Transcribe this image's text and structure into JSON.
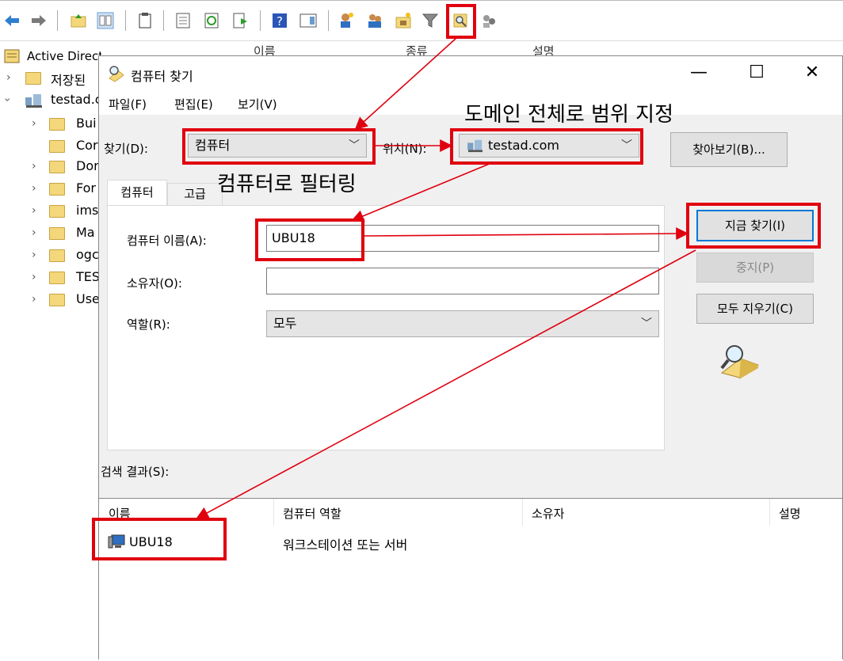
{
  "tree": {
    "root": "Active Directory 사용자 및 컴퓨터",
    "saved": "저장된",
    "domain": "testad.c",
    "children": [
      "Bui",
      "Cor",
      "Dor",
      "For",
      "ims",
      "Ma",
      "ogc",
      "TES",
      "Use"
    ]
  },
  "bg_columns": [
    "이름",
    "종류",
    "설명"
  ],
  "dialog": {
    "title": "컴퓨터 찾기",
    "menu": [
      "파일(F)",
      "편집(E)",
      "보기(V)"
    ],
    "find_label": "찾기(D):",
    "find_value": "컴퓨터",
    "in_label": "위치(N):",
    "in_value": "testad.com",
    "browse_label": "찾아보기(B)...",
    "tabs": [
      "컴퓨터",
      "고급"
    ],
    "name_label": "컴퓨터 이름(A):",
    "name_value": "UBU18",
    "owner_label": "소유자(O):",
    "owner_value": "",
    "role_label": "역할(R):",
    "role_value": "모두",
    "find_now_label": "지금 찾기(I)",
    "stop_label": "중지(P)",
    "clear_label": "모두 지우기(C)",
    "results_label": "검색 결과(S):",
    "columns": [
      "이름",
      "컴퓨터 역할",
      "소유자",
      "설명"
    ],
    "rows": [
      {
        "name": "UBU18",
        "role": "워크스테이션 또는 서버",
        "owner": "",
        "desc": ""
      }
    ]
  },
  "annotations": {
    "domain_scope": "도메인 전체로 범위 지정",
    "filter_computer": "컴퓨터로 필터링"
  },
  "colors": {
    "highlight": "#e0000f",
    "focus": "#0078d7"
  }
}
